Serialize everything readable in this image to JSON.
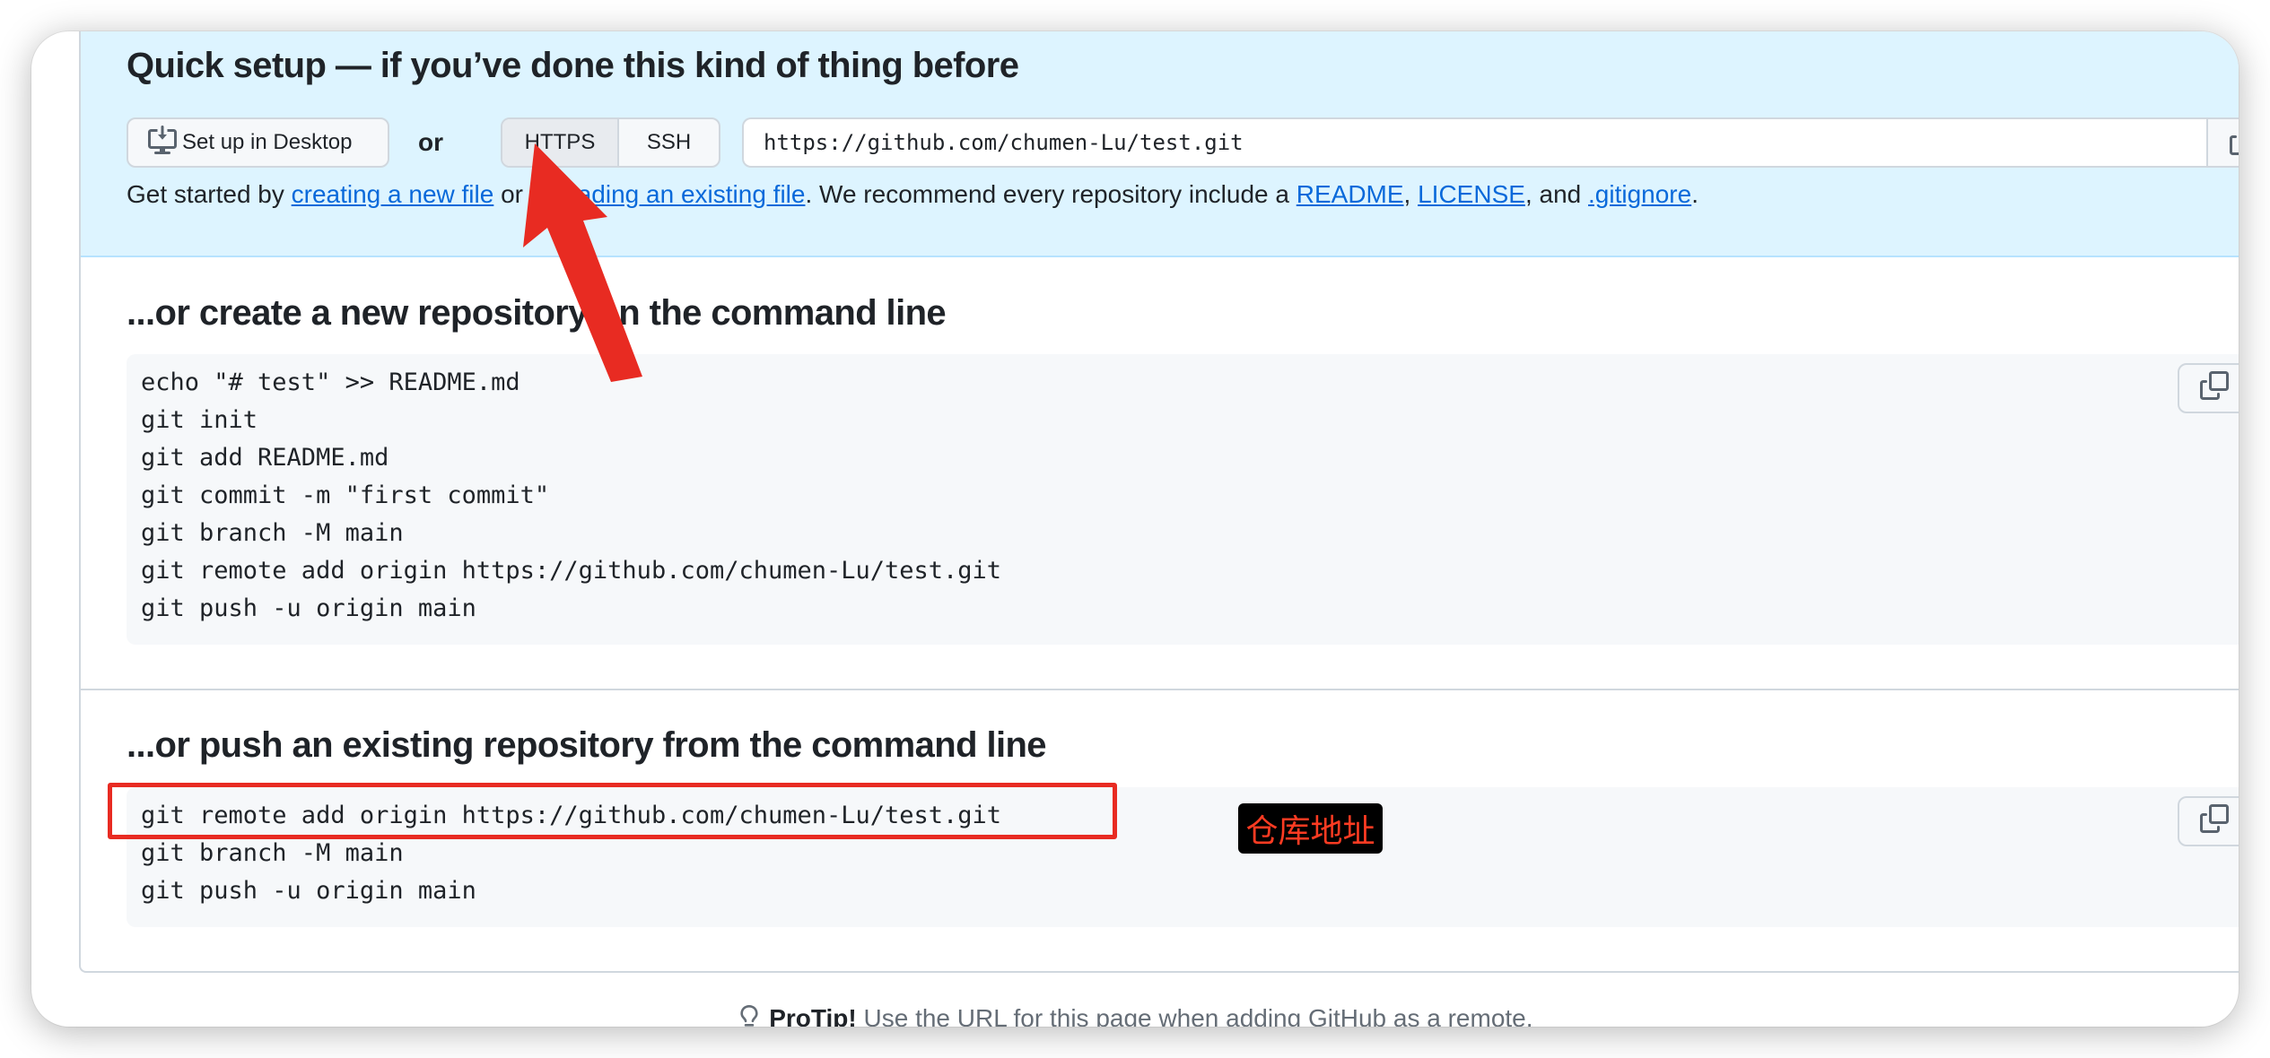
{
  "quick_setup": {
    "title": "Quick setup — if you’ve done this kind of thing before",
    "desktop_button": "Set up in Desktop",
    "or_label": "or",
    "protocols": [
      "HTTPS",
      "SSH"
    ],
    "selected_protocol": "HTTPS",
    "clone_url": "https://github.com/chumen-Lu/test.git",
    "get_started": {
      "prefix": "Get started by ",
      "link1": "creating a new file",
      "mid1": " or ",
      "link2": "uploading an existing file",
      "mid2": ". We recommend every repository include a ",
      "link3": "README",
      "sep1": ", ",
      "link4": "LICENSE",
      "sep2": ", and ",
      "link5": ".gitignore",
      "suffix": "."
    }
  },
  "create_new": {
    "title": "...or create a new repository on the command line",
    "lines": [
      "echo \"# test\" >> README.md",
      "git init",
      "git add README.md",
      "git commit -m \"first commit\"",
      "git branch -M main",
      "git remote add origin https://github.com/chumen-Lu/test.git",
      "git push -u origin main"
    ]
  },
  "push_existing": {
    "title": "...or push an existing repository from the command line",
    "lines": [
      "git remote add origin https://github.com/chumen-Lu/test.git",
      "git branch -M main",
      "git push -u origin main"
    ]
  },
  "protip": {
    "bold": "ProTip!",
    "text": " Use the URL for this page when adding GitHub as a remote."
  },
  "annotation": {
    "label": "仓库地址",
    "color": "#e82b22"
  },
  "icons": {
    "desktop": "desktop-download-icon",
    "copy": "copy-icon",
    "protip": "light-bulb-icon"
  }
}
